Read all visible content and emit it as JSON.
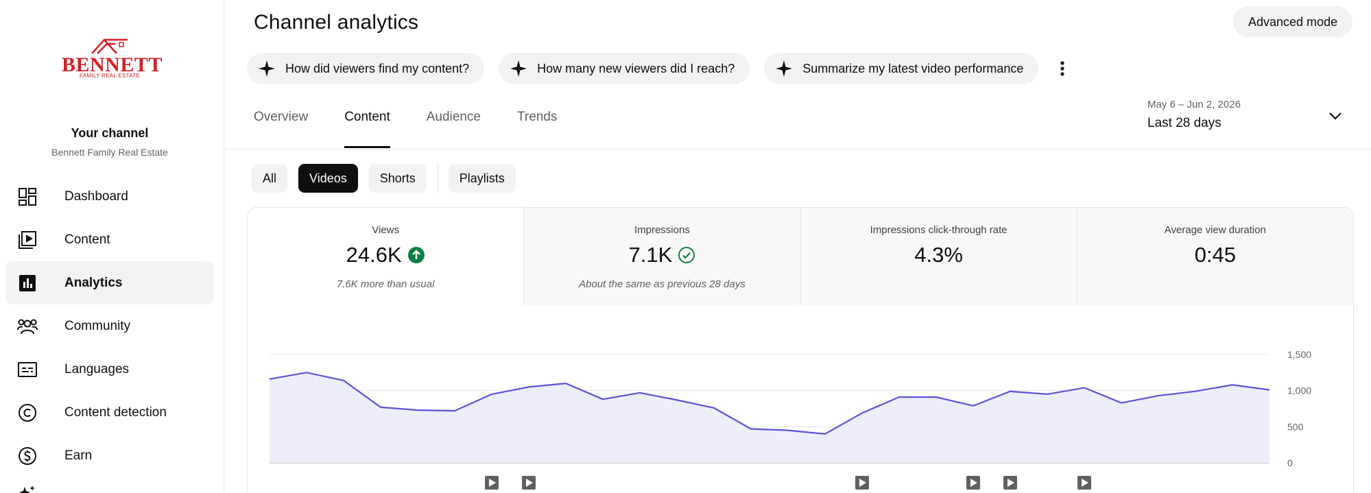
{
  "sidebar": {
    "logo": {
      "brand": "BENNETT",
      "sub": "FAMILY REAL ESTATE"
    },
    "channel_title": "Your channel",
    "channel_name": "Bennett Family Real Estate",
    "items": [
      {
        "label": "Dashboard",
        "icon": "dashboard-icon"
      },
      {
        "label": "Content",
        "icon": "content-icon"
      },
      {
        "label": "Analytics",
        "icon": "analytics-icon",
        "active": true
      },
      {
        "label": "Community",
        "icon": "community-icon"
      },
      {
        "label": "Languages",
        "icon": "languages-icon"
      },
      {
        "label": "Content detection",
        "icon": "copyright-icon"
      },
      {
        "label": "Earn",
        "icon": "dollar-icon"
      }
    ]
  },
  "header": {
    "title": "Channel analytics",
    "advanced_mode": "Advanced mode",
    "suggestions": [
      "How did viewers find my content?",
      "How many new viewers did I reach?",
      "Summarize my latest video performance"
    ]
  },
  "tabs": [
    "Overview",
    "Content",
    "Audience",
    "Trends"
  ],
  "active_tab": "Content",
  "date": {
    "range": "May 6 – Jun 2, 2026",
    "period": "Last 28 days"
  },
  "filters": {
    "all": "All",
    "videos": "Videos",
    "shorts": "Shorts",
    "playlists": "Playlists",
    "selected": "Videos"
  },
  "metrics": [
    {
      "label": "Views",
      "value": "24.6K",
      "note": "7.6K more than usual",
      "status": "up"
    },
    {
      "label": "Impressions",
      "value": "7.1K",
      "note": "About the same as previous 28 days",
      "status": "check"
    },
    {
      "label": "Impressions click-through rate",
      "value": "4.3%",
      "note": ""
    },
    {
      "label": "Average view duration",
      "value": "0:45",
      "note": ""
    }
  ],
  "colors": {
    "accent": "#5c52d9",
    "area_fill": "#eeedfa",
    "up_green": "#0b8043"
  },
  "chart_data": {
    "type": "area",
    "series": [
      {
        "values": [
          1160,
          1250,
          1140,
          770,
          730,
          720,
          950,
          1050,
          1100,
          880,
          970,
          870,
          760,
          470,
          450,
          400,
          690,
          910,
          910,
          790,
          990,
          950,
          1040,
          830,
          930,
          990,
          1080,
          1010
        ]
      }
    ],
    "ylim": [
      0,
      1500
    ],
    "yticks": [
      "0",
      "500",
      "1,000",
      "1,500"
    ],
    "video_markers_at_day_index": [
      6,
      7,
      16,
      19,
      20,
      22
    ]
  }
}
